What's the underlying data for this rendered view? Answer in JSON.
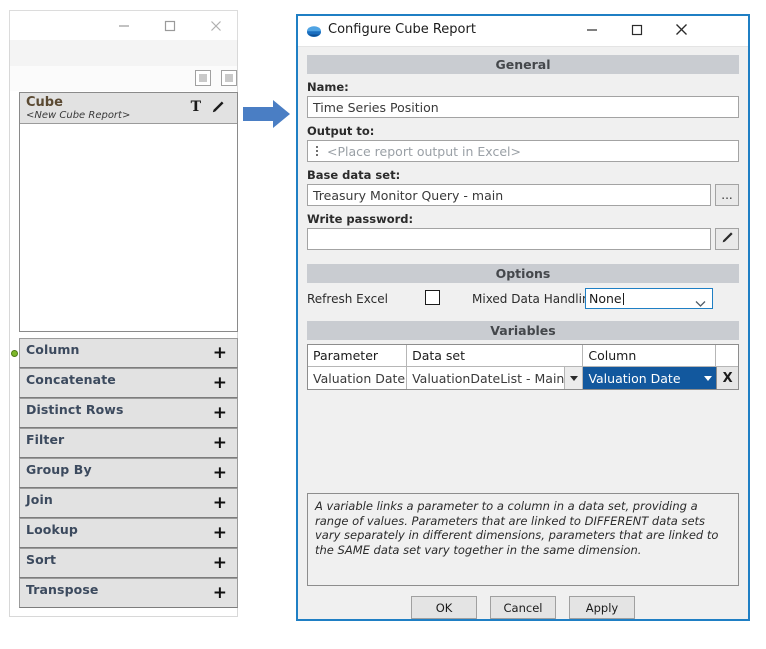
{
  "left_window": {
    "titlebar": {
      "minimize": "minimize-icon",
      "maximize": "maximize-icon",
      "close": "close-icon"
    },
    "toolbar": {
      "button1": "panel-square-button",
      "button2": "panel-square-button"
    },
    "cube_card": {
      "title": "Cube",
      "subtitle": "<New Cube Report>",
      "text_icon": "T",
      "edit_icon": "pencil-icon"
    },
    "operations": [
      {
        "label": "Column",
        "add": "+",
        "selected": true
      },
      {
        "label": "Concatenate",
        "add": "+",
        "selected": false
      },
      {
        "label": "Distinct Rows",
        "add": "+",
        "selected": false
      },
      {
        "label": "Filter",
        "add": "+",
        "selected": false
      },
      {
        "label": "Group By",
        "add": "+",
        "selected": false
      },
      {
        "label": "Join",
        "add": "+",
        "selected": false
      },
      {
        "label": "Lookup",
        "add": "+",
        "selected": false
      },
      {
        "label": "Sort",
        "add": "+",
        "selected": false
      },
      {
        "label": "Transpose",
        "add": "+",
        "selected": false
      }
    ]
  },
  "arrow": {
    "name": "right-arrow-icon",
    "color": "#4a7ec4"
  },
  "dialog": {
    "title": "Configure Cube Report",
    "app_icon": "globe-icon",
    "border_color": "#1f7fc4",
    "titlebar": {
      "minimize": "minimize-icon",
      "maximize": "maximize-icon",
      "close": "close-icon"
    },
    "general": {
      "header": "General",
      "name_label": "Name:",
      "name_value": "Time Series Position",
      "output_label": "Output to:",
      "output_placeholder": "<Place report output in Excel>",
      "output_handle_icon": "drag-dots-icon",
      "baseset_label": "Base data set:",
      "baseset_value": "Treasury Monitor Query - main",
      "baseset_browse": "...",
      "password_label": "Write password:",
      "password_value": "",
      "password_edit_icon": "pencil-icon"
    },
    "options": {
      "header": "Options",
      "refresh_label": "Refresh Excel",
      "refresh_checked": false,
      "mixed_label": "Mixed Data Handling",
      "mixed_value": "None",
      "mixed_options": [
        "None"
      ]
    },
    "variables": {
      "header": "Variables",
      "columns": [
        "Parameter",
        "Data set",
        "Column",
        ""
      ],
      "rows": [
        {
          "parameter": "Valuation Date",
          "data_set": "ValuationDateList - Main",
          "column": "Valuation Date",
          "delete": "X",
          "column_selected": true
        }
      ]
    },
    "description": "A variable links a parameter to a column in a data set, providing a range of values. Parameters that are linked to DIFFERENT data sets vary separately in different dimensions, parameters that are linked to the SAME data set vary together in the same dimension.",
    "buttons": {
      "ok": "OK",
      "cancel": "Cancel",
      "apply": "Apply"
    }
  }
}
